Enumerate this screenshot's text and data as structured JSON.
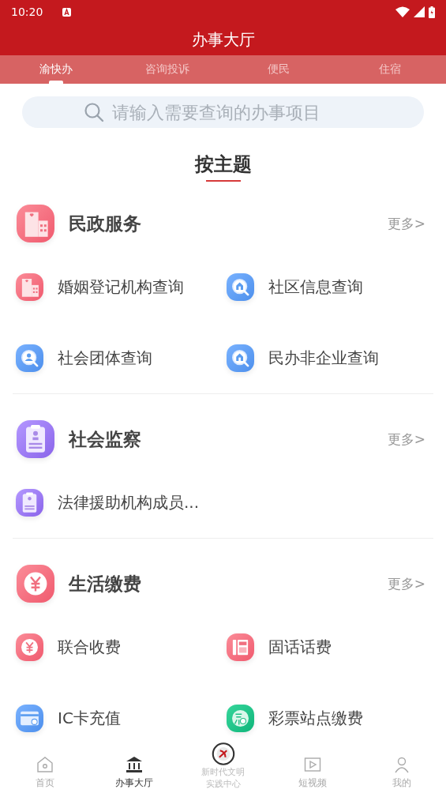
{
  "status_bar": {
    "time": "10:20"
  },
  "title": "办事大厅",
  "tabs": [
    {
      "label": "渝快办",
      "selected": true
    },
    {
      "label": "咨询投诉",
      "selected": false
    },
    {
      "label": "便民",
      "selected": false
    },
    {
      "label": "住宿",
      "selected": false
    }
  ],
  "search": {
    "placeholder": "请输入需要查询的办事项目"
  },
  "heading": "按主题",
  "sections": [
    {
      "title": "民政服务",
      "kind": "building",
      "more": "更多>",
      "items": [
        {
          "label": "婚姻登记机构查询",
          "kind": "building"
        },
        {
          "label": "社区信息查询",
          "kind": "community"
        },
        {
          "label": "社会团体查询",
          "kind": "group"
        },
        {
          "label": "民办非企业查询",
          "kind": "org"
        }
      ]
    },
    {
      "title": "社会监察",
      "kind": "clipboard",
      "more": "更多>",
      "items": [
        {
          "label": "法律援助机构成员...",
          "kind": "clipboard"
        }
      ]
    },
    {
      "title": "生活缴费",
      "kind": "yen",
      "more": "更多>",
      "items": [
        {
          "label": "联合收费",
          "kind": "yen"
        },
        {
          "label": "固话话费",
          "kind": "phone"
        },
        {
          "label": "IC卡充值",
          "kind": "card"
        },
        {
          "label": "彩票站点缴费",
          "kind": "lottery"
        }
      ]
    }
  ],
  "nav": [
    {
      "label": "首页",
      "kind": "home",
      "selected": false
    },
    {
      "label": "办事大厅",
      "kind": "bank",
      "selected": true
    },
    {
      "label": "新时代文明实践中心",
      "kind": "emblem",
      "selected": false
    },
    {
      "label": "短视频",
      "kind": "video",
      "selected": false
    },
    {
      "label": "我的",
      "kind": "person",
      "selected": false
    }
  ]
}
